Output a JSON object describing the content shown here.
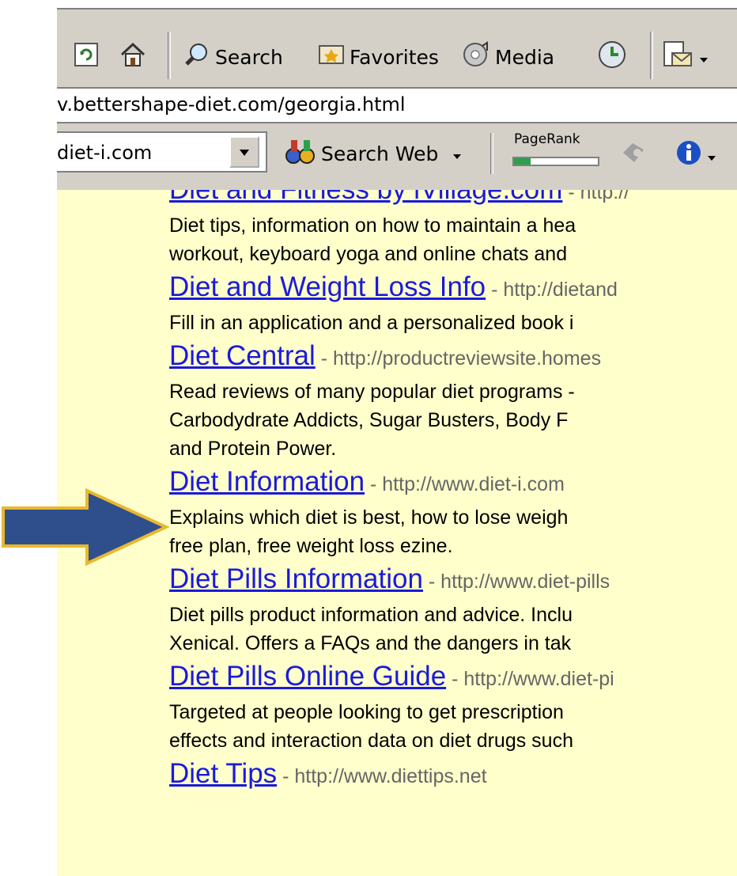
{
  "toolbar": {
    "search_label": "Search",
    "favorites_label": "Favorites",
    "media_label": "Media"
  },
  "address": {
    "url": "v.bettershape-diet.com/georgia.html"
  },
  "google_bar": {
    "search_value": "diet-i.com",
    "search_web_label": "Search Web",
    "pagerank_label": "PageRank",
    "pagerank_level": 0.2
  },
  "results": [
    {
      "title": "Diet and Fitness by iVillage.com",
      "url": "http://",
      "desc": [
        "Diet tips, information on how to maintain a hea",
        "workout, keyboard yoga and online chats and"
      ]
    },
    {
      "title": "Diet and Weight Loss Info",
      "url": "http://dietand",
      "desc": [
        "Fill in an application and a personalized book i"
      ]
    },
    {
      "title": "Diet Central",
      "url": "http://productreviewsite.homes",
      "desc": [
        "Read reviews of many popular diet programs -",
        "Carbodydrate Addicts, Sugar Busters, Body F",
        "and Protein Power."
      ]
    },
    {
      "title": "Diet Information",
      "url": "http://www.diet-i.com",
      "desc": [
        "Explains which diet is best, how to lose weigh",
        "free plan, free weight loss ezine."
      ]
    },
    {
      "title": "Diet Pills Information",
      "url": "http://www.diet-pills",
      "desc": [
        "Diet pills product information and advice. Inclu",
        "Xenical. Offers a FAQs and the dangers in tak"
      ]
    },
    {
      "title": "Diet Pills Online Guide",
      "url": "http://www.diet-pi",
      "desc": [
        "Targeted at people looking to get prescription",
        "effects and interaction data on diet drugs such"
      ]
    },
    {
      "title": "Diet Tips",
      "url": "http://www.diettips.net",
      "desc": []
    }
  ],
  "colors": {
    "link": "#1a1adb",
    "page_background": "#ffffcc",
    "arrow_fill": "#2f4e8c",
    "arrow_border": "#e8b830"
  }
}
